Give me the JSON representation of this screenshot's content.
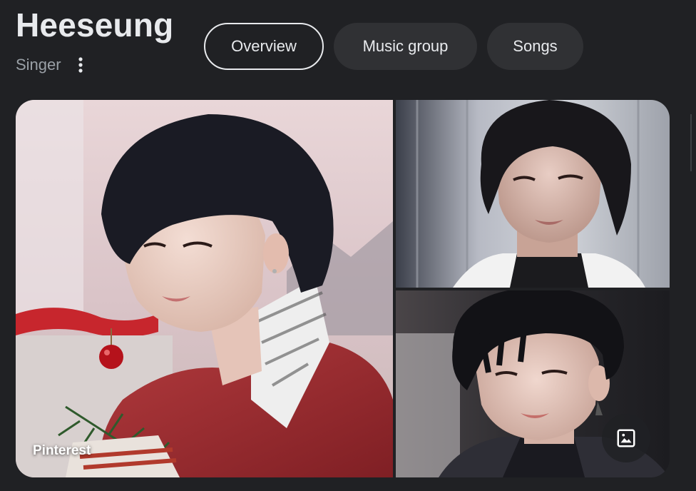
{
  "panel": {
    "title": "Heeseung",
    "subtitle": "Singer"
  },
  "tabs": [
    {
      "label": "Overview",
      "active": true
    },
    {
      "label": "Music group",
      "active": false
    },
    {
      "label": "Songs",
      "active": false
    }
  ],
  "gallery": {
    "main_image_source": "Pinterest",
    "images_icon": "image-icon"
  },
  "colors": {
    "background": "#202124",
    "chip_background": "#303134",
    "text_primary": "#e8eaed",
    "text_secondary": "#9aa0a6"
  }
}
